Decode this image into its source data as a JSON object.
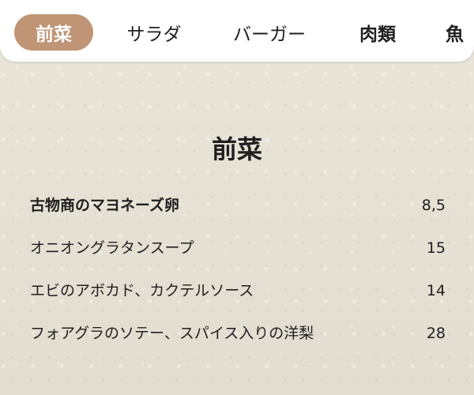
{
  "tabs": [
    {
      "label": "前菜",
      "active": true
    },
    {
      "label": "サラダ",
      "active": false
    },
    {
      "label": "バーガー",
      "active": false
    },
    {
      "label": "肉類",
      "active": false
    },
    {
      "label": "魚",
      "active": false
    }
  ],
  "colors": {
    "accent": "#bf9575",
    "background": "#e6e2d5",
    "tabbar": "#ffffff",
    "text": "#1f1f1f"
  },
  "section": {
    "title": "前菜"
  },
  "menu": {
    "items": [
      {
        "name": "古物商のマヨネーズ卵",
        "price": "8,5"
      },
      {
        "name": "オニオングラタンスープ",
        "price": "15"
      },
      {
        "name": "エビのアボカド、カクテルソース",
        "price": "14"
      },
      {
        "name": "フォアグラのソテー、スパイス入りの洋梨",
        "price": "28"
      }
    ]
  }
}
